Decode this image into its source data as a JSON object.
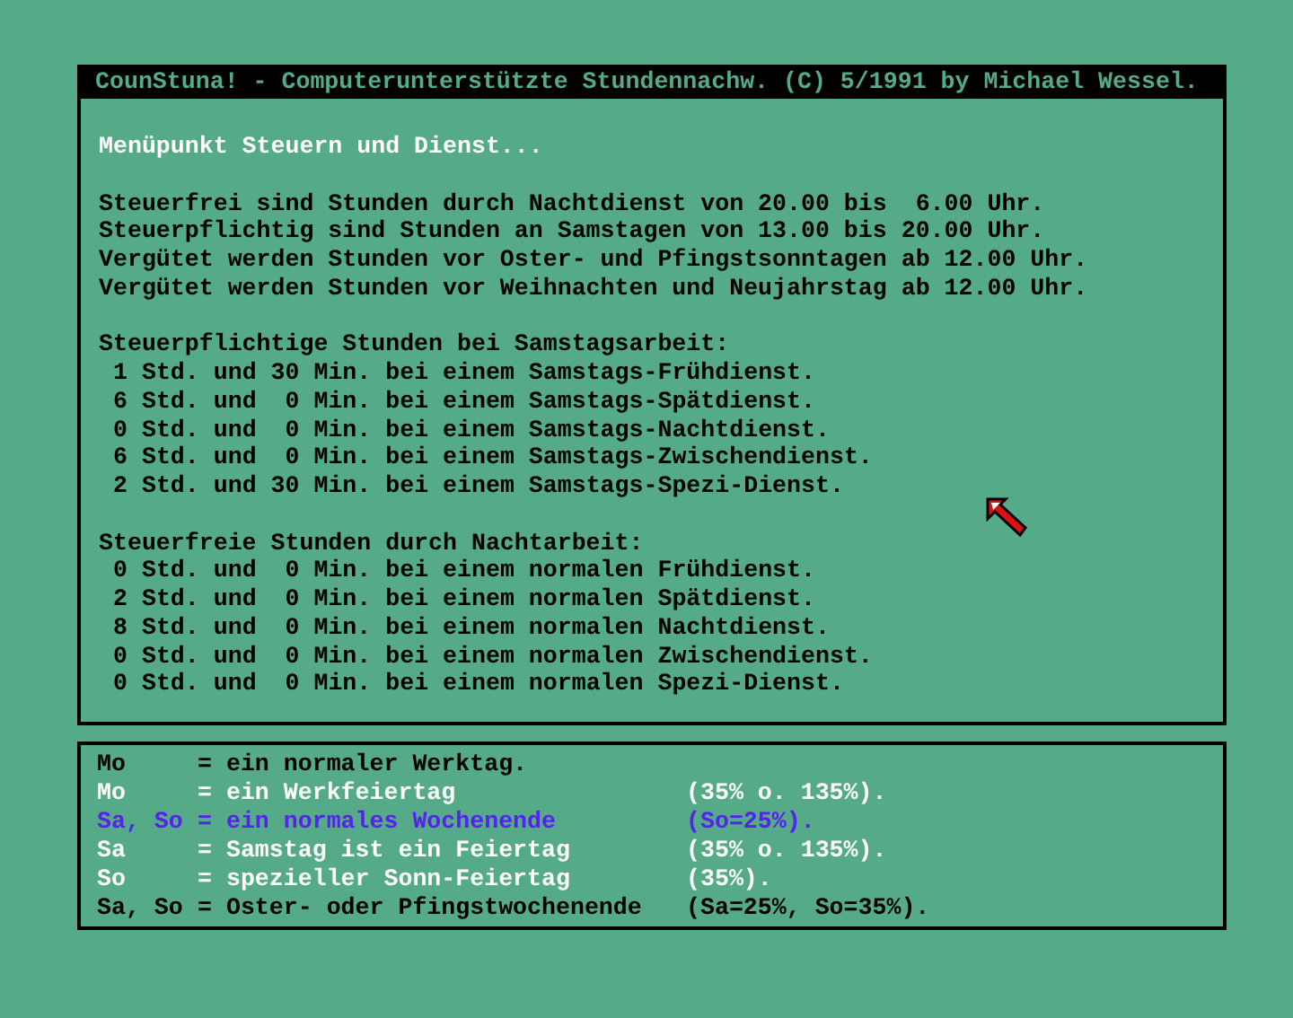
{
  "window": {
    "title": "CounStuna! - Computerunterstützte Stundennachw. (C) 5/1991 by Michael Wessel."
  },
  "heading": "Menüpunkt Steuern und Dienst...",
  "rules": [
    "Steuerfrei sind Stunden durch Nachtdienst von 20.00 bis  6.00 Uhr.",
    "Steuerpflichtig sind Stunden an Samstagen von 13.00 bis 20.00 Uhr.",
    "Vergütet werden Stunden vor Oster- und Pfingstsonntagen ab 12.00 Uhr.",
    "Vergütet werden Stunden vor Weihnachten und Neujahrstag ab 12.00 Uhr."
  ],
  "sections": [
    {
      "heading": "Steuerpflichtige Stunden bei Samstagsarbeit:",
      "lines": [
        "1 Std. und 30 Min. bei einem Samstags-Frühdienst.",
        "6 Std. und  0 Min. bei einem Samstags-Spätdienst.",
        "0 Std. und  0 Min. bei einem Samstags-Nachtdienst.",
        "6 Std. und  0 Min. bei einem Samstags-Zwischendienst.",
        "2 Std. und 30 Min. bei einem Samstags-Spezi-Dienst."
      ]
    },
    {
      "heading": "Steuerfreie Stunden durch Nachtarbeit:",
      "lines": [
        "0 Std. und  0 Min. bei einem normalen Frühdienst.",
        "2 Std. und  0 Min. bei einem normalen Spätdienst.",
        "8 Std. und  0 Min. bei einem normalen Nachtdienst.",
        "0 Std. und  0 Min. bei einem normalen Zwischendienst.",
        "0 Std. und  0 Min. bei einem normalen Spezi-Dienst."
      ]
    }
  ],
  "legend": [
    {
      "key": "Mo",
      "meaning": "= ein normaler Werktag.",
      "color": "#000000"
    },
    {
      "key": "Mo",
      "meaning": "= ein Werkfeiertag",
      "note": "(35% o. 135%).",
      "color": "#ffffff"
    },
    {
      "key": "Sa, So",
      "meaning": "= ein normales Wochenende",
      "note": "(So=25%).",
      "color": "#5522ee"
    },
    {
      "key": "Sa",
      "meaning": "= Samstag ist ein Feiertag",
      "note": "(35% o. 135%).",
      "color": "#ffffff"
    },
    {
      "key": "So",
      "meaning": "= spezieller Sonn-Feiertag",
      "note": "(35%).",
      "color": "#ffffff"
    },
    {
      "key": "Sa, So",
      "meaning": "= Oster- oder Pfingstwochenende",
      "note": "(Sa=25%, So=35%).",
      "color": "#000000"
    }
  ]
}
